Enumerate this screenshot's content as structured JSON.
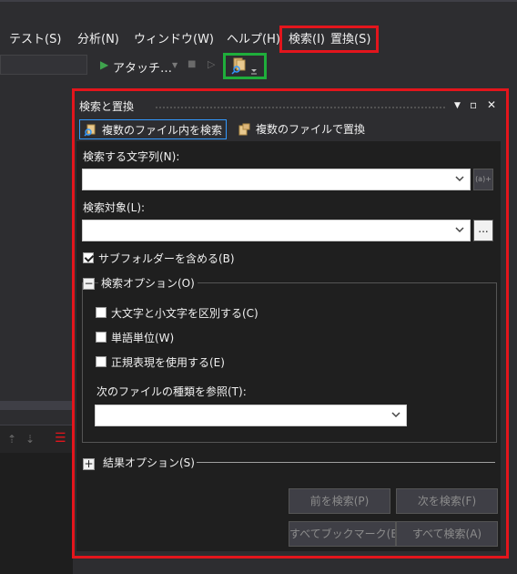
{
  "menu": {
    "items": [
      {
        "label": "テスト(S)"
      },
      {
        "label": "分析(N)"
      },
      {
        "label": "ウィンドウ(W)"
      },
      {
        "label": "ヘルプ(H)"
      },
      {
        "label": "検索(I)"
      },
      {
        "label": "置換(S)"
      }
    ]
  },
  "toolbar": {
    "attach_label": "アタッチ…",
    "icons": [
      "play-icon",
      "dropdown-arrow-icon",
      "stop-icon",
      "step-icon",
      "find-in-files-icon"
    ]
  },
  "dialog": {
    "title": "検索と置換",
    "tabs": [
      {
        "label": "複数のファイル内を検索",
        "active": true
      },
      {
        "label": "複数のファイルで置換",
        "active": false
      }
    ],
    "find_what_label": "検索する文字列(N):",
    "find_what_value": "",
    "look_in_label": "検索対象(L):",
    "look_in_value": "",
    "browse_label": "...",
    "regex_hint": "(a)+",
    "include_subfolders_label": "サブフォルダーを含める(B)",
    "include_subfolders_checked": true,
    "find_options_label": "検索オプション(O)",
    "match_case_label": "大文字と小文字を区別する(C)",
    "whole_word_label": "単語単位(W)",
    "regex_label": "正規表現を使用する(E)",
    "file_types_label": "次のファイルの種類を参照(T):",
    "file_types_value": "",
    "result_options_label": "結果オプション(S)",
    "buttons": {
      "find_prev": "前を検索(P)",
      "find_next": "次を検索(F)",
      "bookmark_all": "すべてブックマーク(B)",
      "find_all": "すべて検索(A)"
    }
  },
  "colors": {
    "background": "#2d2d30",
    "highlight_red": "#e3151c",
    "highlight_green": "#1fae3b",
    "accent_blue": "#3399ff"
  }
}
